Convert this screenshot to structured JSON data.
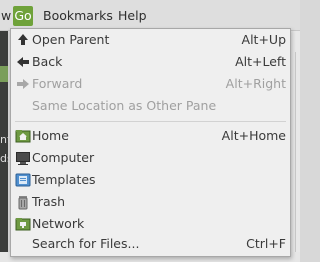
{
  "menubar": {
    "partial_item": "w",
    "items": [
      "Go",
      "Bookmarks",
      "Help"
    ]
  },
  "background": {
    "edge_text_1": "nt",
    "edge_text_2": "ds"
  },
  "go_menu": {
    "items": [
      {
        "label": "Open Parent",
        "shortcut": "Alt+Up",
        "icon": "up-arrow-icon",
        "enabled": true
      },
      {
        "label": "Back",
        "shortcut": "Alt+Left",
        "icon": "left-arrow-icon",
        "enabled": true
      },
      {
        "label": "Forward",
        "shortcut": "Alt+Right",
        "icon": "right-arrow-icon",
        "enabled": false
      },
      {
        "label": "Same Location as Other Pane",
        "shortcut": "",
        "icon": "",
        "enabled": false
      },
      {
        "label": "Home",
        "shortcut": "Alt+Home",
        "icon": "home-folder-icon",
        "enabled": true
      },
      {
        "label": "Computer",
        "shortcut": "",
        "icon": "computer-icon",
        "enabled": true
      },
      {
        "label": "Templates",
        "shortcut": "",
        "icon": "templates-folder-icon",
        "enabled": true
      },
      {
        "label": "Trash",
        "shortcut": "",
        "icon": "trash-icon",
        "enabled": true
      },
      {
        "label": "Network",
        "shortcut": "",
        "icon": "network-folder-icon",
        "enabled": true
      },
      {
        "label": "Search for Files...",
        "shortcut": "Ctrl+F",
        "icon": "",
        "enabled": true
      }
    ]
  },
  "colors": {
    "menu_highlight": "#6fa23a",
    "menu_background": "#efefef",
    "disabled_text": "#a0a0a0"
  }
}
